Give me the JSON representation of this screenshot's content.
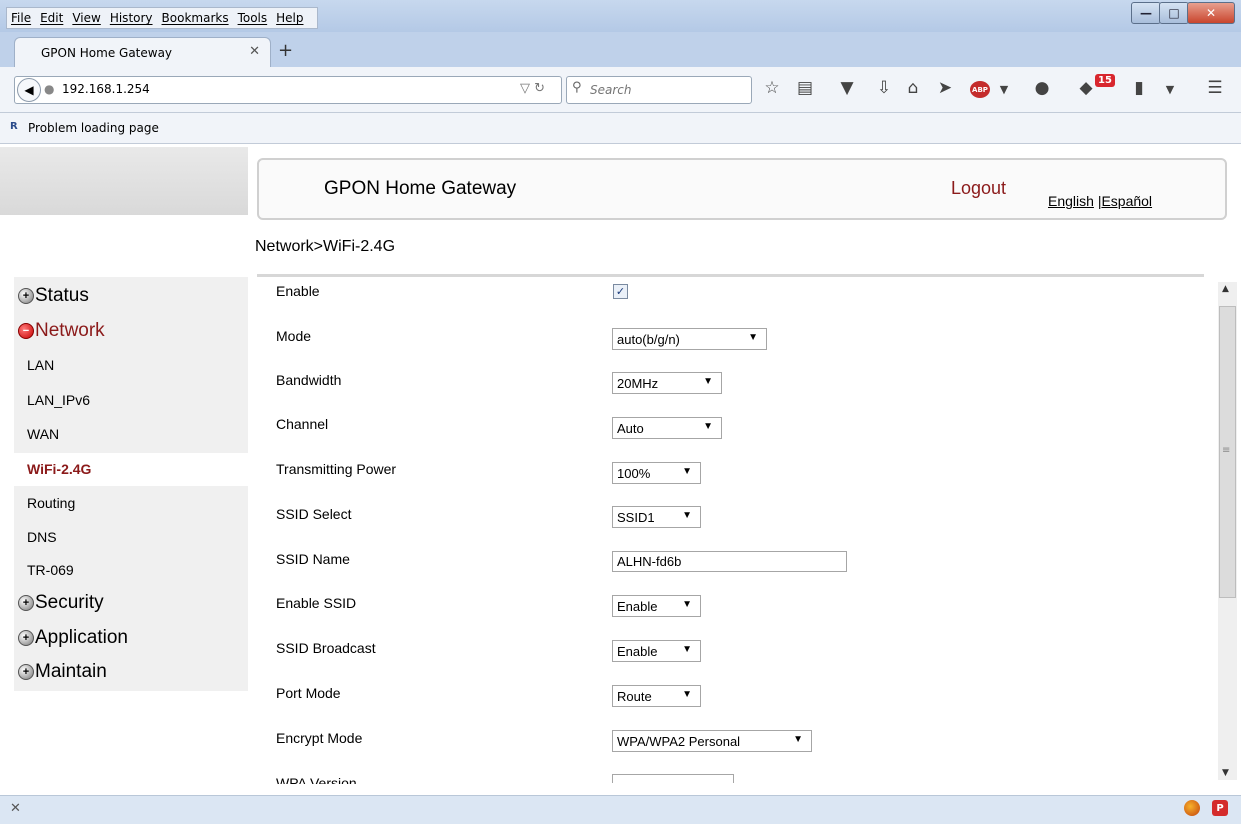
{
  "browser": {
    "menu": [
      "File",
      "Edit",
      "View",
      "History",
      "Bookmarks",
      "Tools",
      "Help"
    ],
    "tab_title": "GPON Home Gateway",
    "url": "192.168.1.254",
    "search_placeholder": "Search",
    "notification_count": "15",
    "bookmark_label": "Problem loading page",
    "bookmark_icon_text": "R",
    "abp_label": "ABP",
    "toolbar_icons": [
      "star-icon",
      "reading-list-icon",
      "pocket-icon",
      "download-icon",
      "home-icon",
      "send-icon",
      "adblock-icon",
      "chat-icon",
      "puzzle-icon",
      "clipboard-icon",
      "menu-icon"
    ]
  },
  "header": {
    "title": "GPON Home Gateway",
    "logout": "Logout",
    "lang_en": "English",
    "lang_sep": "|",
    "lang_es": "Español"
  },
  "breadcrumb": "Network>WiFi-2.4G",
  "sidebar": {
    "groups": [
      "Status",
      "Network",
      "Security",
      "Application",
      "Maintain"
    ],
    "network_items": [
      "LAN",
      "LAN_IPv6",
      "WAN",
      "WiFi-2.4G",
      "Routing",
      "DNS",
      "TR-069"
    ],
    "active_item": "WiFi-2.4G"
  },
  "form": {
    "enable_label": "Enable",
    "enable_checked": true,
    "mode_label": "Mode",
    "mode_value": "auto(b/g/n)",
    "bandwidth_label": "Bandwidth",
    "bandwidth_value": "20MHz",
    "channel_label": "Channel",
    "channel_value": "Auto",
    "tx_power_label": "Transmitting Power",
    "tx_power_value": "100%",
    "ssid_select_label": "SSID Select",
    "ssid_select_value": "SSID1",
    "ssid_name_label": "SSID Name",
    "ssid_name_value": "ALHN-fd6b",
    "enable_ssid_label": "Enable SSID",
    "enable_ssid_value": "Enable",
    "ssid_broadcast_label": "SSID Broadcast",
    "ssid_broadcast_value": "Enable",
    "port_mode_label": "Port Mode",
    "port_mode_value": "Route",
    "encrypt_mode_label": "Encrypt Mode",
    "encrypt_mode_value": "WPA/WPA2 Personal",
    "wpa_version_label": "WPA Version"
  },
  "colors": {
    "active_nav": "#8b1a1a",
    "logout": "#8b1a1a",
    "sidebar_bg": "#f0f0f0"
  }
}
